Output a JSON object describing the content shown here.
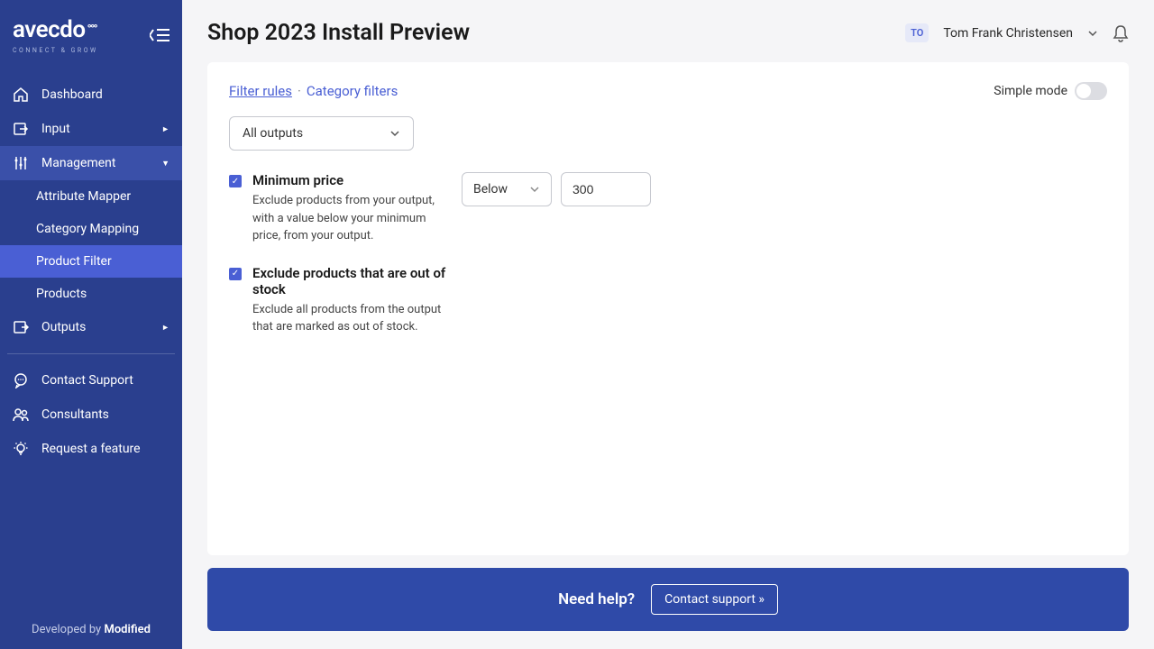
{
  "logo": {
    "main": "avecdo",
    "sub": "CONNECT & GROW"
  },
  "sidebar": {
    "items": [
      {
        "label": "Dashboard"
      },
      {
        "label": "Input"
      },
      {
        "label": "Management"
      },
      {
        "label": "Outputs"
      }
    ],
    "management_sub": [
      {
        "label": "Attribute Mapper"
      },
      {
        "label": "Category Mapping"
      },
      {
        "label": "Product Filter"
      },
      {
        "label": "Products"
      }
    ],
    "support": [
      {
        "label": "Contact Support"
      },
      {
        "label": "Consultants"
      },
      {
        "label": "Request a feature"
      }
    ],
    "footer_prefix": "Developed by ",
    "footer_brand": "Modified"
  },
  "header": {
    "title": "Shop 2023 Install Preview",
    "user_initials": "TO",
    "user_name": "Tom Frank Christensen"
  },
  "tabs": {
    "filter_rules": "Filter rules",
    "category_filters": "Category filters",
    "simple_mode": "Simple mode"
  },
  "output_selector": "All outputs",
  "filters": [
    {
      "title": "Minimum price",
      "desc": "Exclude products from your output, with a value below your minimum price, from your output.",
      "condition": "Below",
      "value": "300"
    },
    {
      "title": "Exclude products that are out of stock",
      "desc": "Exclude all products from the output that are marked as out of stock."
    }
  ],
  "help": {
    "text": "Need help?",
    "button": "Contact support »"
  }
}
